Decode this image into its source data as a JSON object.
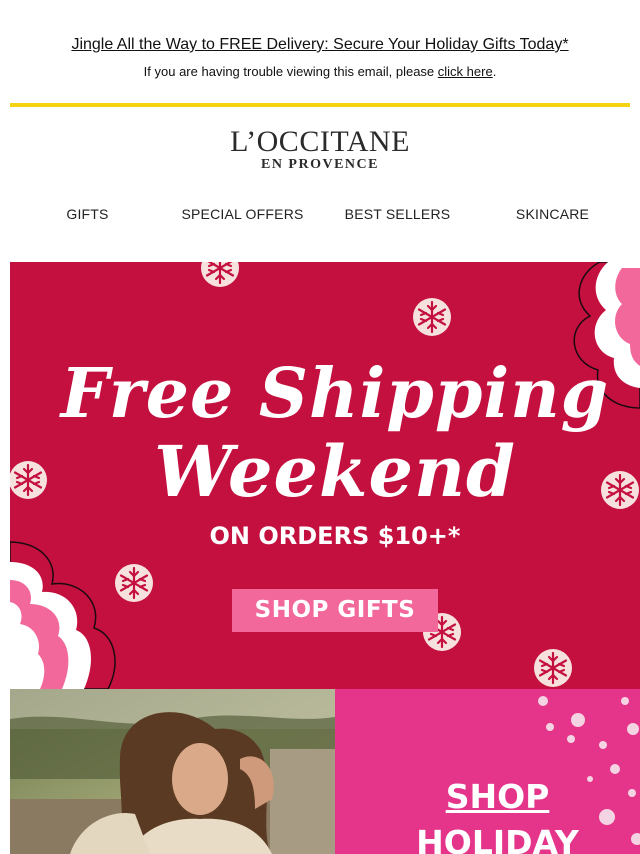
{
  "preheader": {
    "headline": "Jingle All the Way to FREE Delivery: Secure Your Holiday Gifts Today*",
    "trouble_text": "If you are having trouble viewing this email, please ",
    "trouble_link": "click here",
    "trouble_end": "."
  },
  "brand": {
    "name": "L’OCCITANE",
    "sub": "EN PROVENCE"
  },
  "nav": {
    "items": [
      "GIFTS",
      "SPECIAL OFFERS",
      "BEST SELLERS",
      "SKINCARE"
    ]
  },
  "hero": {
    "title_line1": "Free Shipping",
    "title_line2": "Weekend",
    "subtitle": "ON ORDERS $10+*",
    "cta": "SHOP GIFTS"
  },
  "promo": {
    "line1": "SHOP",
    "line2": "HOLIDAY"
  },
  "colors": {
    "hero_bg": "#c4103f",
    "cta_bg": "#f2689a",
    "promo_bg": "#e5358a",
    "rule": "#f5d20f"
  },
  "icons": [
    "snowflake-icon",
    "cloud-swirl-icon"
  ]
}
